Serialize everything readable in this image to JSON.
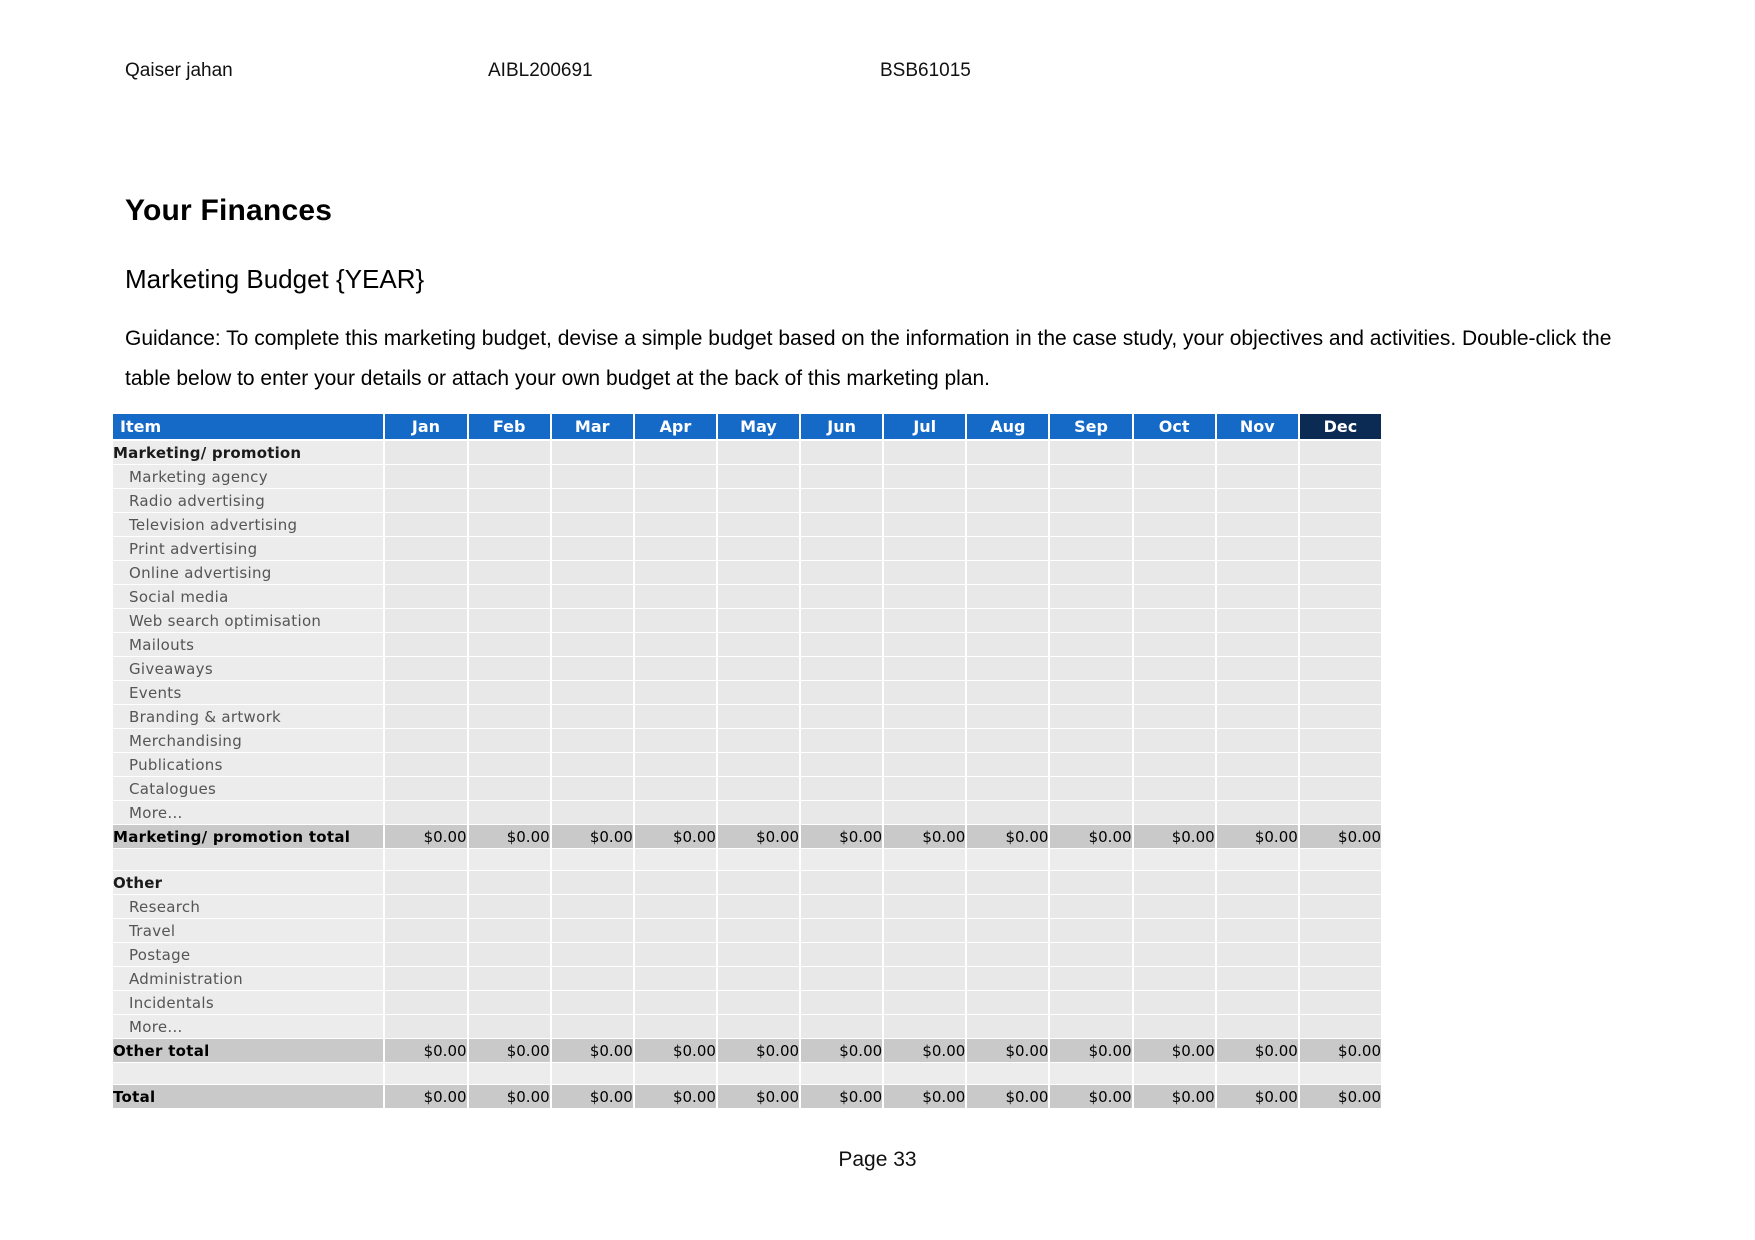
{
  "header": {
    "student_name": "Qaiser jahan",
    "student_id": "AIBL200691",
    "course_code": "BSB61015"
  },
  "title": "Your Finances",
  "subtitle": "Marketing Budget {YEAR}",
  "guidance": "Guidance: To complete this marketing budget, devise a simple budget based on the information in the case study, your objectives and activities. Double-click the table below to enter your details or attach your own budget at the back of this marketing plan.",
  "footer": {
    "page_label": "Page 33"
  },
  "colors": {
    "header_blue": "#1569c7",
    "header_active": "#0b2b55",
    "row_grey": "#e8e8e8",
    "total_grey": "#c9c9c9"
  },
  "table": {
    "columns": [
      "Item",
      "Jan",
      "Feb",
      "Mar",
      "Apr",
      "May",
      "Jun",
      "Jul",
      "Aug",
      "Sep",
      "Oct",
      "Nov",
      "Dec"
    ],
    "active_column": "Dec",
    "zero_value": "$0.00",
    "empty_value": "",
    "rows": [
      {
        "label": "Marketing/ promotion",
        "kind": "group",
        "values": [
          "",
          "",
          "",
          "",
          "",
          "",
          "",
          "",
          "",
          "",
          "",
          ""
        ]
      },
      {
        "label": "Marketing agency",
        "kind": "sub",
        "values": [
          "",
          "",
          "",
          "",
          "",
          "",
          "",
          "",
          "",
          "",
          "",
          ""
        ]
      },
      {
        "label": "Radio advertising",
        "kind": "sub",
        "values": [
          "",
          "",
          "",
          "",
          "",
          "",
          "",
          "",
          "",
          "",
          "",
          ""
        ]
      },
      {
        "label": "Television advertising",
        "kind": "sub",
        "values": [
          "",
          "",
          "",
          "",
          "",
          "",
          "",
          "",
          "",
          "",
          "",
          ""
        ]
      },
      {
        "label": "Print advertising",
        "kind": "sub",
        "values": [
          "",
          "",
          "",
          "",
          "",
          "",
          "",
          "",
          "",
          "",
          "",
          ""
        ]
      },
      {
        "label": "Online advertising",
        "kind": "sub",
        "values": [
          "",
          "",
          "",
          "",
          "",
          "",
          "",
          "",
          "",
          "",
          "",
          ""
        ]
      },
      {
        "label": "Social media",
        "kind": "sub",
        "values": [
          "",
          "",
          "",
          "",
          "",
          "",
          "",
          "",
          "",
          "",
          "",
          ""
        ]
      },
      {
        "label": "Web search optimisation",
        "kind": "sub",
        "values": [
          "",
          "",
          "",
          "",
          "",
          "",
          "",
          "",
          "",
          "",
          "",
          ""
        ]
      },
      {
        "label": "Mailouts",
        "kind": "sub",
        "values": [
          "",
          "",
          "",
          "",
          "",
          "",
          "",
          "",
          "",
          "",
          "",
          ""
        ]
      },
      {
        "label": "Giveaways",
        "kind": "sub",
        "values": [
          "",
          "",
          "",
          "",
          "",
          "",
          "",
          "",
          "",
          "",
          "",
          ""
        ]
      },
      {
        "label": "Events",
        "kind": "sub",
        "values": [
          "",
          "",
          "",
          "",
          "",
          "",
          "",
          "",
          "",
          "",
          "",
          ""
        ]
      },
      {
        "label": "Branding & artwork",
        "kind": "sub",
        "values": [
          "",
          "",
          "",
          "",
          "",
          "",
          "",
          "",
          "",
          "",
          "",
          ""
        ]
      },
      {
        "label": "Merchandising",
        "kind": "sub",
        "values": [
          "",
          "",
          "",
          "",
          "",
          "",
          "",
          "",
          "",
          "",
          "",
          ""
        ]
      },
      {
        "label": "Publications",
        "kind": "sub",
        "values": [
          "",
          "",
          "",
          "",
          "",
          "",
          "",
          "",
          "",
          "",
          "",
          ""
        ]
      },
      {
        "label": "Catalogues",
        "kind": "sub",
        "values": [
          "",
          "",
          "",
          "",
          "",
          "",
          "",
          "",
          "",
          "",
          "",
          ""
        ]
      },
      {
        "label": "More...",
        "kind": "sub",
        "values": [
          "",
          "",
          "",
          "",
          "",
          "",
          "",
          "",
          "",
          "",
          "",
          ""
        ]
      },
      {
        "label": "Marketing/ promotion total",
        "kind": "total",
        "values": [
          "$0.00",
          "$0.00",
          "$0.00",
          "$0.00",
          "$0.00",
          "$0.00",
          "$0.00",
          "$0.00",
          "$0.00",
          "$0.00",
          "$0.00",
          "$0.00"
        ]
      },
      {
        "label": "",
        "kind": "blank",
        "values": [
          "",
          "",
          "",
          "",
          "",
          "",
          "",
          "",
          "",
          "",
          "",
          ""
        ]
      },
      {
        "label": "Other",
        "kind": "group",
        "values": [
          "",
          "",
          "",
          "",
          "",
          "",
          "",
          "",
          "",
          "",
          "",
          ""
        ]
      },
      {
        "label": "Research",
        "kind": "sub",
        "values": [
          "",
          "",
          "",
          "",
          "",
          "",
          "",
          "",
          "",
          "",
          "",
          ""
        ]
      },
      {
        "label": "Travel",
        "kind": "sub",
        "values": [
          "",
          "",
          "",
          "",
          "",
          "",
          "",
          "",
          "",
          "",
          "",
          ""
        ]
      },
      {
        "label": "Postage",
        "kind": "sub",
        "values": [
          "",
          "",
          "",
          "",
          "",
          "",
          "",
          "",
          "",
          "",
          "",
          ""
        ]
      },
      {
        "label": "Administration",
        "kind": "sub",
        "values": [
          "",
          "",
          "",
          "",
          "",
          "",
          "",
          "",
          "",
          "",
          "",
          ""
        ]
      },
      {
        "label": "Incidentals",
        "kind": "sub",
        "values": [
          "",
          "",
          "",
          "",
          "",
          "",
          "",
          "",
          "",
          "",
          "",
          ""
        ]
      },
      {
        "label": "More...",
        "kind": "sub",
        "values": [
          "",
          "",
          "",
          "",
          "",
          "",
          "",
          "",
          "",
          "",
          "",
          ""
        ]
      },
      {
        "label": "Other total",
        "kind": "total",
        "values": [
          "$0.00",
          "$0.00",
          "$0.00",
          "$0.00",
          "$0.00",
          "$0.00",
          "$0.00",
          "$0.00",
          "$0.00",
          "$0.00",
          "$0.00",
          "$0.00"
        ]
      },
      {
        "label": "",
        "kind": "blank",
        "values": [
          "",
          "",
          "",
          "",
          "",
          "",
          "",
          "",
          "",
          "",
          "",
          ""
        ]
      },
      {
        "label": "Total",
        "kind": "total",
        "values": [
          "$0.00",
          "$0.00",
          "$0.00",
          "$0.00",
          "$0.00",
          "$0.00",
          "$0.00",
          "$0.00",
          "$0.00",
          "$0.00",
          "$0.00",
          "$0.00"
        ]
      }
    ]
  }
}
